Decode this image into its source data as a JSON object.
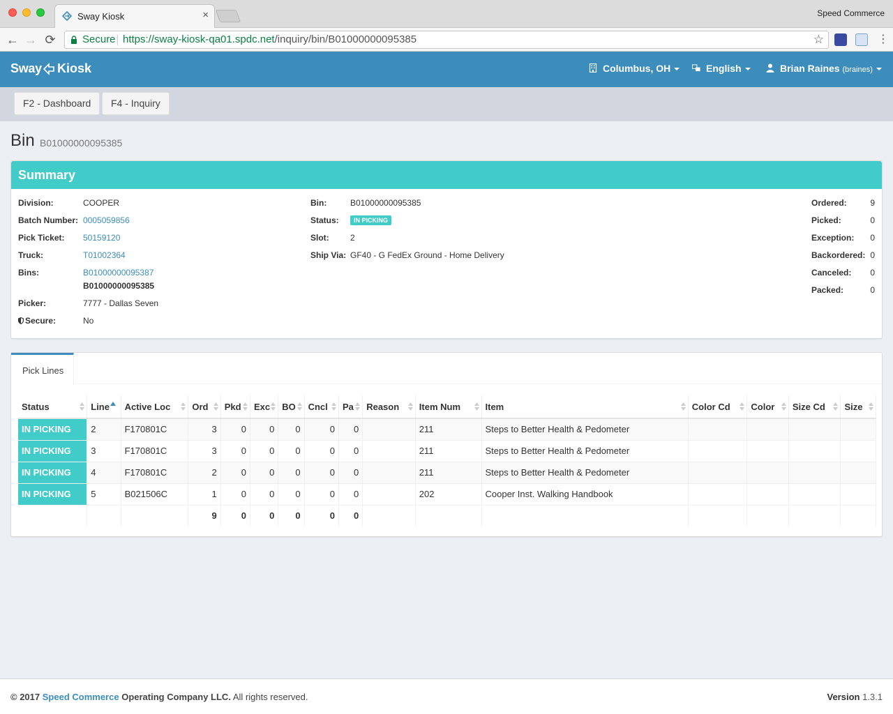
{
  "browser": {
    "tab_title": "Sway Kiosk",
    "tab_close": "×",
    "profile": "Speed Commerce",
    "secure_label": "Secure",
    "url_host": "https://sway-kiosk-qa01.spdc.net",
    "url_path": "/inquiry/bin/B01000000095385",
    "icons": {
      "back": "←",
      "forward": "→",
      "reload": "⟳",
      "star": "☆",
      "menu": "⋮"
    }
  },
  "header": {
    "brand_left": "Sway",
    "brand_right": "Kiosk",
    "location": "Columbus, OH",
    "language": "English",
    "user_name": "Brian Raines",
    "user_login": "(braines)",
    "brand_color": "#3c8dbc"
  },
  "function_keys": [
    {
      "label": "F2 - Dashboard"
    },
    {
      "label": "F4 - Inquiry"
    }
  ],
  "page": {
    "title": "Bin",
    "subtitle": "B01000000095385"
  },
  "summary": {
    "header": "Summary",
    "accent_color": "#41cbc9",
    "left": {
      "division_label": "Division:",
      "division": "COOPER",
      "batch_label": "Batch Number:",
      "batch": "0005059856",
      "pick_ticket_label": "Pick Ticket:",
      "pick_ticket": "50159120",
      "truck_label": "Truck:",
      "truck": "T01002364",
      "bins_label": "Bins:",
      "bins": [
        "B01000000095387",
        "B01000000095385"
      ],
      "picker_label": "Picker:",
      "picker": "7777 - Dallas Seven",
      "secure_label": "Secure:",
      "secure": "No"
    },
    "middle": {
      "bin_label": "Bin:",
      "bin": "B01000000095385",
      "status_label": "Status:",
      "status": "IN PICKING",
      "slot_label": "Slot:",
      "slot": "2",
      "ship_via_label": "Ship Via:",
      "ship_via": "GF40 - G FedEx Ground - Home Delivery"
    },
    "right": [
      {
        "label": "Ordered:",
        "value": "9"
      },
      {
        "label": "Picked:",
        "value": "0"
      },
      {
        "label": "Exception:",
        "value": "0"
      },
      {
        "label": "Backordered:",
        "value": "0"
      },
      {
        "label": "Canceled:",
        "value": "0"
      },
      {
        "label": "Packed:",
        "value": "0"
      }
    ]
  },
  "pick_lines": {
    "tab_label": "Pick Lines",
    "columns": [
      "Status",
      "Line",
      "Active Loc",
      "Ord",
      "Pkd",
      "Exc",
      "BO",
      "Cncl",
      "Pa",
      "Reason",
      "Item Num",
      "Item",
      "Color Cd",
      "Color",
      "Size Cd",
      "Size"
    ],
    "sorted_column": "Line",
    "rows": [
      {
        "status": "IN PICKING",
        "line": "2",
        "loc": "F170801C",
        "ord": "3",
        "pkd": "0",
        "exc": "0",
        "bo": "0",
        "cncl": "0",
        "pa": "0",
        "reason": "",
        "item_num": "211",
        "item": "Steps to Better Health & Pedometer",
        "color_cd": "",
        "color": "",
        "size_cd": "",
        "size": ""
      },
      {
        "status": "IN PICKING",
        "line": "3",
        "loc": "F170801C",
        "ord": "3",
        "pkd": "0",
        "exc": "0",
        "bo": "0",
        "cncl": "0",
        "pa": "0",
        "reason": "",
        "item_num": "211",
        "item": "Steps to Better Health & Pedometer",
        "color_cd": "",
        "color": "",
        "size_cd": "",
        "size": ""
      },
      {
        "status": "IN PICKING",
        "line": "4",
        "loc": "F170801C",
        "ord": "2",
        "pkd": "0",
        "exc": "0",
        "bo": "0",
        "cncl": "0",
        "pa": "0",
        "reason": "",
        "item_num": "211",
        "item": "Steps to Better Health & Pedometer",
        "color_cd": "",
        "color": "",
        "size_cd": "",
        "size": ""
      },
      {
        "status": "IN PICKING",
        "line": "5",
        "loc": "B021506C",
        "ord": "1",
        "pkd": "0",
        "exc": "0",
        "bo": "0",
        "cncl": "0",
        "pa": "0",
        "reason": "",
        "item_num": "202",
        "item": "Cooper Inst. Walking Handbook",
        "color_cd": "",
        "color": "",
        "size_cd": "",
        "size": ""
      }
    ],
    "totals": {
      "ord": "9",
      "pkd": "0",
      "exc": "0",
      "bo": "0",
      "cncl": "0",
      "pa": "0"
    }
  },
  "footer": {
    "copyright": "© 2017",
    "company_link": "Speed Commerce",
    "company_rest": "Operating Company LLC.",
    "rights": "All rights reserved.",
    "version_label": "Version",
    "version": "1.3.1"
  }
}
